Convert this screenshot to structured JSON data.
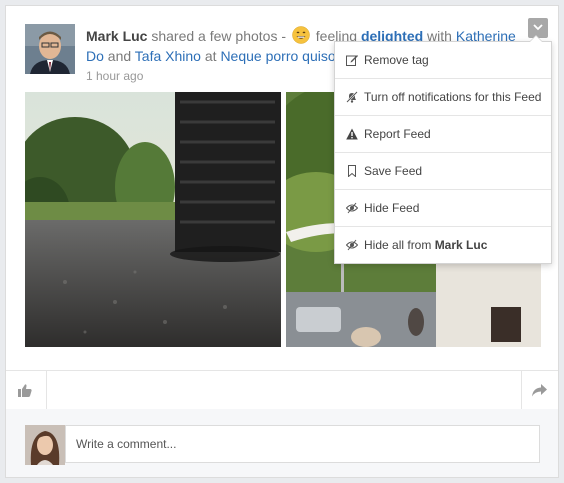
{
  "post": {
    "author": "Mark Luc",
    "action_text": " shared a few photos - ",
    "feeling_prefix": " feeling ",
    "feeling": "delighted",
    "with_text": " with ",
    "tagged_1": "Katherine Do",
    "and_text": " and ",
    "tagged_2": "Tafa Xhino",
    "at_text": " at ",
    "location": "Neque porro quiso",
    "timestamp": "1 hour ago",
    "feeling_icon": "grinning-face-emoji"
  },
  "menu": {
    "items": [
      {
        "label": "Remove tag",
        "icon": "edit-icon"
      },
      {
        "label": "Turn off notifications for this Feed",
        "icon": "bell-slash-icon"
      },
      {
        "label": "Report Feed",
        "icon": "warning-icon"
      },
      {
        "label": "Save Feed",
        "icon": "bookmark-icon"
      },
      {
        "label": "Hide Feed",
        "icon": "eye-slash-icon"
      }
    ],
    "hide_all_prefix": "Hide all from ",
    "hide_all_name": "Mark Luc",
    "hide_all_icon": "eye-slash-icon"
  },
  "actions": {
    "like_icon": "thumbs-up-icon",
    "share_icon": "share-icon"
  },
  "comment": {
    "placeholder": "Write a comment..."
  },
  "colors": {
    "link": "#2d6fb7",
    "muted": "#7a7a7a"
  }
}
